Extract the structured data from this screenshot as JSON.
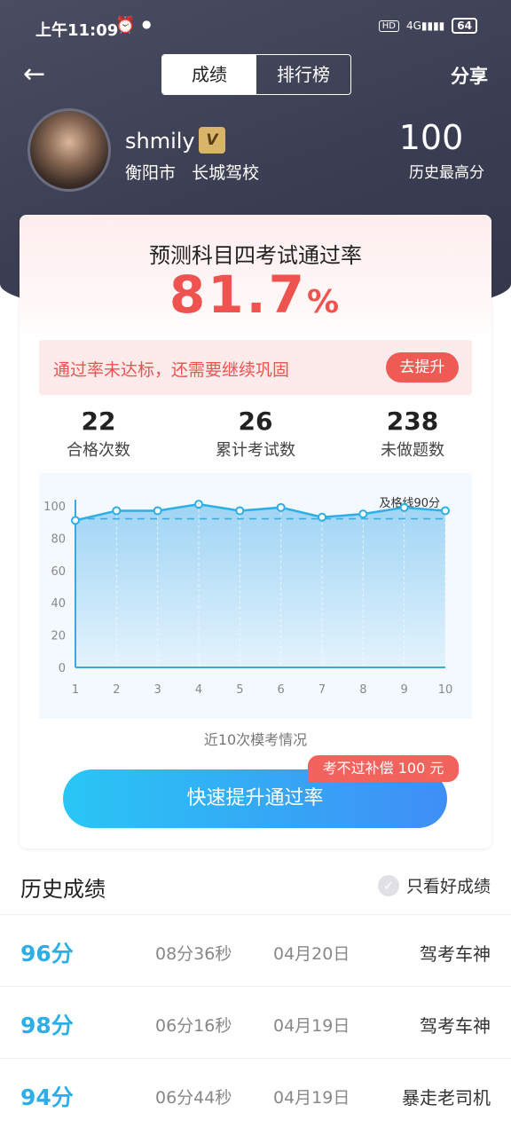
{
  "status_bar": {
    "time": "上午11:09",
    "alarm_icon": "alarm-clock-icon",
    "hd": "HD",
    "network": "4G",
    "battery": "64"
  },
  "nav": {
    "back_icon": "arrow-left-icon",
    "tabs": [
      {
        "label": "成绩",
        "active": true
      },
      {
        "label": "排行榜",
        "active": false
      }
    ],
    "share_label": "分享"
  },
  "profile": {
    "username": "shmily",
    "vip_badge": "V",
    "city": "衡阳市",
    "school": "长城驾校",
    "best_score": "100",
    "best_label": "历史最高分"
  },
  "prediction": {
    "title": "预测科目四考试通过率",
    "rate": "81.7",
    "rate_unit": "%",
    "warning": "通过率未达标，还需要继续巩固",
    "warning_button": "去提升"
  },
  "stats": [
    {
      "value": "22",
      "label": "合格次数"
    },
    {
      "value": "26",
      "label": "累计考试数"
    },
    {
      "value": "238",
      "label": "未做题数"
    }
  ],
  "chart_data": {
    "type": "area",
    "x": [
      1,
      2,
      3,
      4,
      5,
      6,
      7,
      8,
      9,
      10
    ],
    "values": [
      91,
      97,
      97,
      101,
      97,
      99,
      93,
      95,
      99,
      97
    ],
    "y_ticks": [
      0,
      20,
      40,
      60,
      80,
      100
    ],
    "ylim": [
      0,
      105
    ],
    "threshold": {
      "value": 92,
      "label": "及格线90分"
    },
    "caption": "近10次模考情况",
    "color": "#2eaee6"
  },
  "cta": {
    "label": "快速提升通过率",
    "tag": "考不过补偿 100 元"
  },
  "history": {
    "title": "历史成绩",
    "filter_label": "只看好成绩",
    "rows": [
      {
        "score": "96分",
        "duration": "08分36秒",
        "date": "04月20日",
        "title": "驾考车神"
      },
      {
        "score": "98分",
        "duration": "06分16秒",
        "date": "04月19日",
        "title": "驾考车神"
      },
      {
        "score": "94分",
        "duration": "06分44秒",
        "date": "04月19日",
        "title": "暴走老司机"
      }
    ]
  }
}
